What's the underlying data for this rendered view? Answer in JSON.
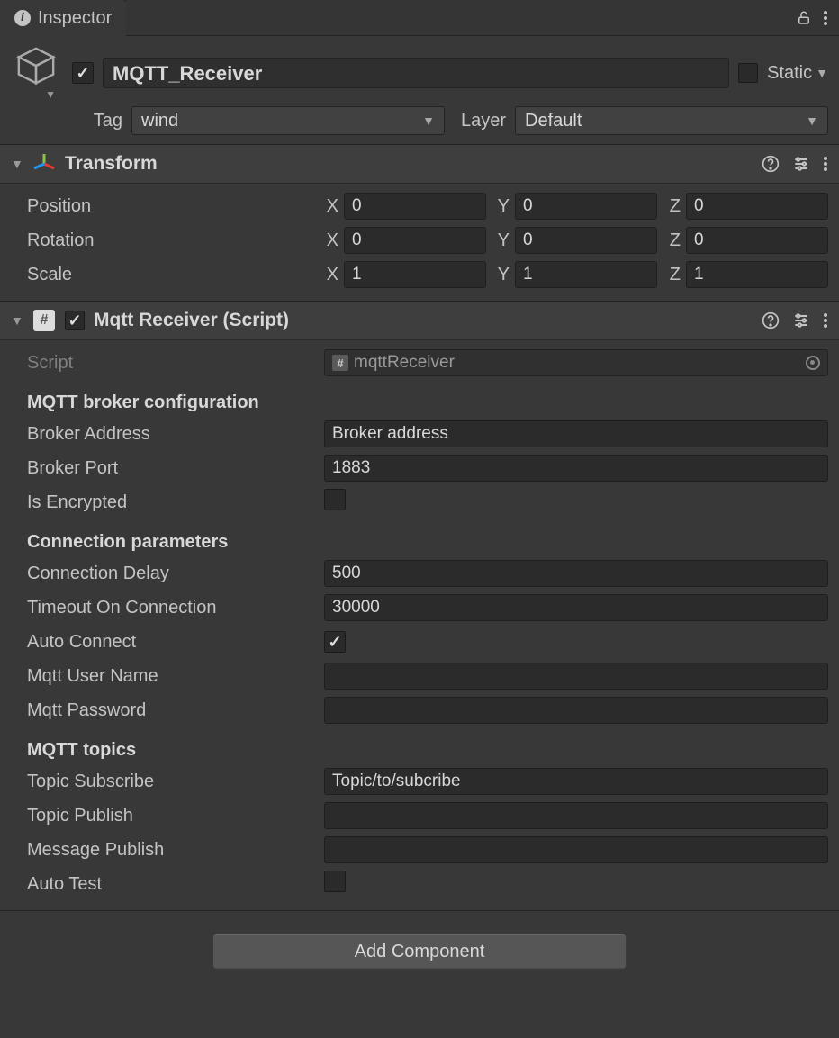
{
  "tab": {
    "title": "Inspector"
  },
  "gameObject": {
    "name": "MQTT_Receiver",
    "enabled": true,
    "staticLabel": "Static",
    "static": false,
    "tagLabel": "Tag",
    "tag": "wind",
    "layerLabel": "Layer",
    "layer": "Default"
  },
  "transform": {
    "title": "Transform",
    "position": {
      "label": "Position",
      "x": "0",
      "y": "0",
      "z": "0"
    },
    "rotation": {
      "label": "Rotation",
      "x": "0",
      "y": "0",
      "z": "0"
    },
    "scale": {
      "label": "Scale",
      "x": "1",
      "y": "1",
      "z": "1"
    },
    "axes": {
      "x": "X",
      "y": "Y",
      "z": "Z"
    }
  },
  "mqtt": {
    "title": "Mqtt Receiver (Script)",
    "enabled": true,
    "scriptLabel": "Script",
    "scriptName": "mqttReceiver",
    "groups": {
      "broker": {
        "title": "MQTT broker configuration",
        "address": {
          "label": "Broker Address",
          "value": "Broker address"
        },
        "port": {
          "label": "Broker Port",
          "value": "1883"
        },
        "encrypted": {
          "label": "Is Encrypted",
          "value": false
        }
      },
      "conn": {
        "title": "Connection parameters",
        "delay": {
          "label": "Connection Delay",
          "value": "500"
        },
        "timeout": {
          "label": "Timeout On Connection",
          "value": "30000"
        },
        "auto": {
          "label": "Auto Connect",
          "value": true
        },
        "user": {
          "label": "Mqtt User Name",
          "value": ""
        },
        "pass": {
          "label": "Mqtt Password",
          "value": ""
        }
      },
      "topics": {
        "title": "MQTT topics",
        "sub": {
          "label": "Topic Subscribe",
          "value": "Topic/to/subcribe"
        },
        "pub": {
          "label": "Topic Publish",
          "value": ""
        },
        "msg": {
          "label": "Message Publish",
          "value": ""
        },
        "test": {
          "label": "Auto Test",
          "value": false
        }
      }
    }
  },
  "addComponent": "Add Component"
}
